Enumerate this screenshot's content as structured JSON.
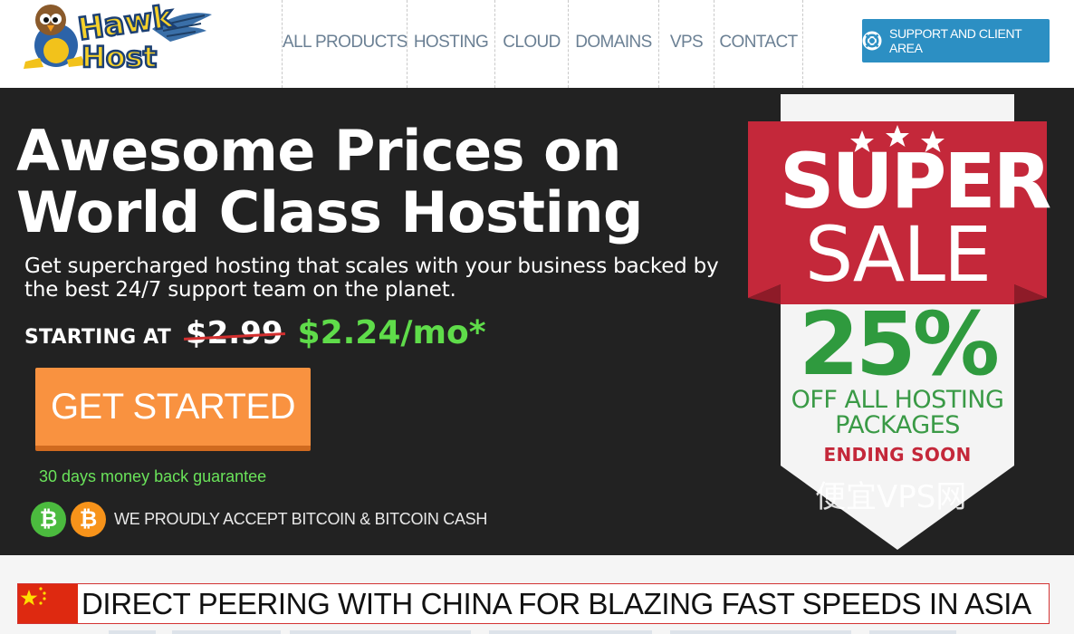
{
  "header": {
    "logo_text": "Hawk Host",
    "nav": [
      {
        "label": "ALL PRODUCTS"
      },
      {
        "label": "HOSTING"
      },
      {
        "label": "CLOUD"
      },
      {
        "label": "DOMAINS"
      },
      {
        "label": "VPS"
      },
      {
        "label": "CONTACT"
      }
    ],
    "support_label": "SUPPORT AND CLIENT AREA",
    "support_icon": "lifebuoy-icon"
  },
  "hero": {
    "title_line1": "Awesome Prices on",
    "title_line2": "World Class Hosting",
    "subtitle": "Get supercharged hosting that scales with your business backed by the best 24/7 support team on the planet.",
    "starting_label": "STARTING AT",
    "old_price": "$2.99",
    "new_price": "$2.24/mo*",
    "cta_label": "GET STARTED",
    "guarantee": "30 days money back guarantee",
    "crypto_text": "WE PROUDLY ACCEPT BITCOIN & BITCOIN CASH",
    "coin_symbol": "₿"
  },
  "sale_badge": {
    "super": "SUPER",
    "sale": "SALE",
    "percent": "25%",
    "off_line1": "OFF ALL HOSTING",
    "off_line2": "PACKAGES",
    "ending": "ENDING SOON"
  },
  "watermark": "便宜VPS网",
  "banner": {
    "text": "DIRECT PEERING WITH CHINA FOR BLAZING FAST SPEEDS IN ASIA"
  },
  "colors": {
    "hero_bg": "#222222",
    "accent_blue": "#2c8fc3",
    "cta_orange": "#f99240",
    "price_green": "#5fdc4a",
    "sale_red": "#c4283a"
  }
}
